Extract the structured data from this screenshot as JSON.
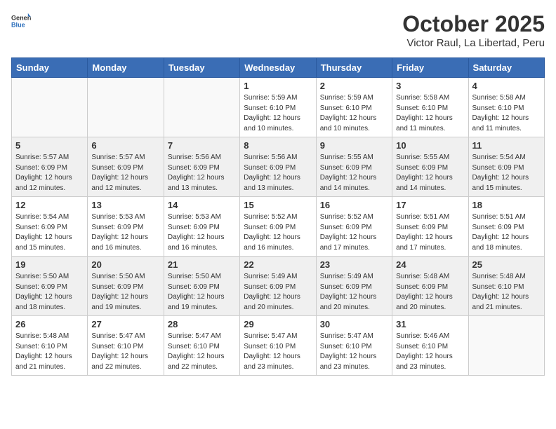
{
  "header": {
    "logo_general": "General",
    "logo_blue": "Blue",
    "title": "October 2025",
    "subtitle": "Victor Raul, La Libertad, Peru"
  },
  "days_of_week": [
    "Sunday",
    "Monday",
    "Tuesday",
    "Wednesday",
    "Thursday",
    "Friday",
    "Saturday"
  ],
  "weeks": [
    [
      {
        "day": "",
        "info": ""
      },
      {
        "day": "",
        "info": ""
      },
      {
        "day": "",
        "info": ""
      },
      {
        "day": "1",
        "info": "Sunrise: 5:59 AM\nSunset: 6:10 PM\nDaylight: 12 hours\nand 10 minutes."
      },
      {
        "day": "2",
        "info": "Sunrise: 5:59 AM\nSunset: 6:10 PM\nDaylight: 12 hours\nand 10 minutes."
      },
      {
        "day": "3",
        "info": "Sunrise: 5:58 AM\nSunset: 6:10 PM\nDaylight: 12 hours\nand 11 minutes."
      },
      {
        "day": "4",
        "info": "Sunrise: 5:58 AM\nSunset: 6:10 PM\nDaylight: 12 hours\nand 11 minutes."
      }
    ],
    [
      {
        "day": "5",
        "info": "Sunrise: 5:57 AM\nSunset: 6:09 PM\nDaylight: 12 hours\nand 12 minutes."
      },
      {
        "day": "6",
        "info": "Sunrise: 5:57 AM\nSunset: 6:09 PM\nDaylight: 12 hours\nand 12 minutes."
      },
      {
        "day": "7",
        "info": "Sunrise: 5:56 AM\nSunset: 6:09 PM\nDaylight: 12 hours\nand 13 minutes."
      },
      {
        "day": "8",
        "info": "Sunrise: 5:56 AM\nSunset: 6:09 PM\nDaylight: 12 hours\nand 13 minutes."
      },
      {
        "day": "9",
        "info": "Sunrise: 5:55 AM\nSunset: 6:09 PM\nDaylight: 12 hours\nand 14 minutes."
      },
      {
        "day": "10",
        "info": "Sunrise: 5:55 AM\nSunset: 6:09 PM\nDaylight: 12 hours\nand 14 minutes."
      },
      {
        "day": "11",
        "info": "Sunrise: 5:54 AM\nSunset: 6:09 PM\nDaylight: 12 hours\nand 15 minutes."
      }
    ],
    [
      {
        "day": "12",
        "info": "Sunrise: 5:54 AM\nSunset: 6:09 PM\nDaylight: 12 hours\nand 15 minutes."
      },
      {
        "day": "13",
        "info": "Sunrise: 5:53 AM\nSunset: 6:09 PM\nDaylight: 12 hours\nand 16 minutes."
      },
      {
        "day": "14",
        "info": "Sunrise: 5:53 AM\nSunset: 6:09 PM\nDaylight: 12 hours\nand 16 minutes."
      },
      {
        "day": "15",
        "info": "Sunrise: 5:52 AM\nSunset: 6:09 PM\nDaylight: 12 hours\nand 16 minutes."
      },
      {
        "day": "16",
        "info": "Sunrise: 5:52 AM\nSunset: 6:09 PM\nDaylight: 12 hours\nand 17 minutes."
      },
      {
        "day": "17",
        "info": "Sunrise: 5:51 AM\nSunset: 6:09 PM\nDaylight: 12 hours\nand 17 minutes."
      },
      {
        "day": "18",
        "info": "Sunrise: 5:51 AM\nSunset: 6:09 PM\nDaylight: 12 hours\nand 18 minutes."
      }
    ],
    [
      {
        "day": "19",
        "info": "Sunrise: 5:50 AM\nSunset: 6:09 PM\nDaylight: 12 hours\nand 18 minutes."
      },
      {
        "day": "20",
        "info": "Sunrise: 5:50 AM\nSunset: 6:09 PM\nDaylight: 12 hours\nand 19 minutes."
      },
      {
        "day": "21",
        "info": "Sunrise: 5:50 AM\nSunset: 6:09 PM\nDaylight: 12 hours\nand 19 minutes."
      },
      {
        "day": "22",
        "info": "Sunrise: 5:49 AM\nSunset: 6:09 PM\nDaylight: 12 hours\nand 20 minutes."
      },
      {
        "day": "23",
        "info": "Sunrise: 5:49 AM\nSunset: 6:09 PM\nDaylight: 12 hours\nand 20 minutes."
      },
      {
        "day": "24",
        "info": "Sunrise: 5:48 AM\nSunset: 6:09 PM\nDaylight: 12 hours\nand 20 minutes."
      },
      {
        "day": "25",
        "info": "Sunrise: 5:48 AM\nSunset: 6:10 PM\nDaylight: 12 hours\nand 21 minutes."
      }
    ],
    [
      {
        "day": "26",
        "info": "Sunrise: 5:48 AM\nSunset: 6:10 PM\nDaylight: 12 hours\nand 21 minutes."
      },
      {
        "day": "27",
        "info": "Sunrise: 5:47 AM\nSunset: 6:10 PM\nDaylight: 12 hours\nand 22 minutes."
      },
      {
        "day": "28",
        "info": "Sunrise: 5:47 AM\nSunset: 6:10 PM\nDaylight: 12 hours\nand 22 minutes."
      },
      {
        "day": "29",
        "info": "Sunrise: 5:47 AM\nSunset: 6:10 PM\nDaylight: 12 hours\nand 23 minutes."
      },
      {
        "day": "30",
        "info": "Sunrise: 5:47 AM\nSunset: 6:10 PM\nDaylight: 12 hours\nand 23 minutes."
      },
      {
        "day": "31",
        "info": "Sunrise: 5:46 AM\nSunset: 6:10 PM\nDaylight: 12 hours\nand 23 minutes."
      },
      {
        "day": "",
        "info": ""
      }
    ]
  ]
}
